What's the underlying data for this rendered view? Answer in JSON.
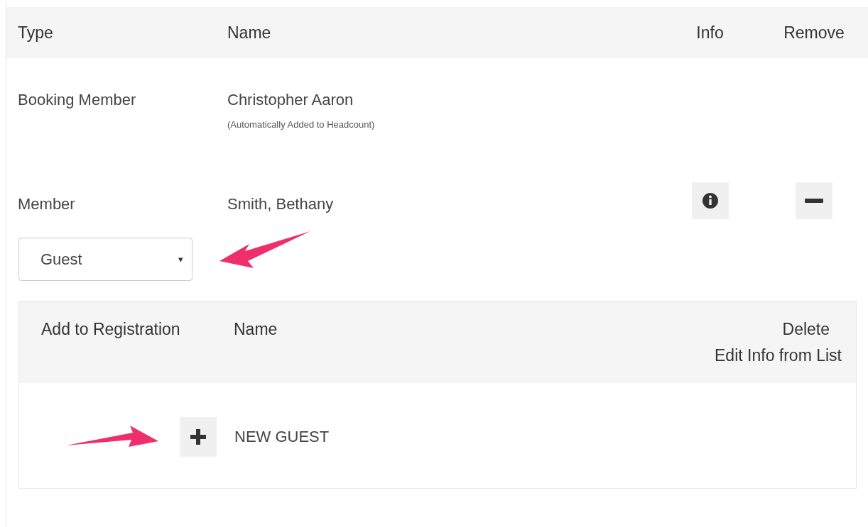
{
  "table": {
    "columns": [
      "Type",
      "Name",
      "Info",
      "Remove"
    ],
    "rows": [
      {
        "type": "Booking Member",
        "name": "Christopher Aaron",
        "note": "(Automatically Added to Headcount)",
        "has_actions": false
      },
      {
        "type": "Member",
        "name": "Smith, Bethany",
        "has_actions": true
      }
    ]
  },
  "guest_select": {
    "value": "Guest",
    "caret": "▾"
  },
  "guest_panel": {
    "columns": [
      "Add to Registration",
      "Name"
    ],
    "column_3": [
      "Delete",
      "Edit Info from List"
    ],
    "rows": [
      {
        "name": "NEW GUEST"
      }
    ]
  },
  "annotations": [
    {
      "kind": "arrow-left"
    },
    {
      "kind": "arrow-right"
    }
  ]
}
